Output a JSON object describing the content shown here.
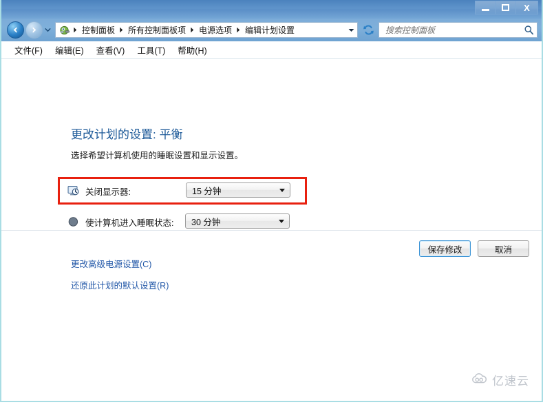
{
  "window": {
    "border_color": "#a9dde4",
    "titlebar_color": "#5b8fc7",
    "controls": {
      "minimize_label": "–",
      "maximize_label": "□",
      "close_label": "X"
    }
  },
  "navbar": {
    "back_icon": "back-arrow-icon",
    "forward_icon": "forward-arrow-icon",
    "history_caret_icon": "chevron-down-icon",
    "breadcrumb_icon": "control-panel-icon",
    "crumbs": [
      "控制面板",
      "所有控制面板项",
      "电源选项",
      "编辑计划设置"
    ],
    "crumb_dropdown_icon": "chevron-down-icon",
    "refresh_icon": "refresh-icon",
    "search": {
      "placeholder": "搜索控制面板",
      "value": "",
      "icon": "search-icon"
    }
  },
  "menubar": {
    "items": [
      "文件(F)",
      "编辑(E)",
      "查看(V)",
      "工具(T)",
      "帮助(H)"
    ]
  },
  "content": {
    "title": "更改计划的设置: 平衡",
    "subtitle": "选择希望计算机使用的睡眠设置和显示设置。",
    "settings": [
      {
        "icon": "monitor-clock-icon",
        "label": "关闭显示器:",
        "value": "15 分钟",
        "highlighted": true
      },
      {
        "icon": "sleep-moon-icon",
        "label": "使计算机进入睡眠状态:",
        "value": "30 分钟",
        "highlighted": false
      }
    ],
    "links": [
      "更改高级电源设置(C)",
      "还原此计划的默认设置(R)"
    ],
    "buttons": {
      "save_label": "保存修改",
      "cancel_label": "取消"
    },
    "highlight_color": "#e8200f",
    "link_color": "#2358a8",
    "title_color": "#1c5998"
  },
  "watermark": {
    "text": "亿速云",
    "icon": "cloud-logo-icon"
  }
}
